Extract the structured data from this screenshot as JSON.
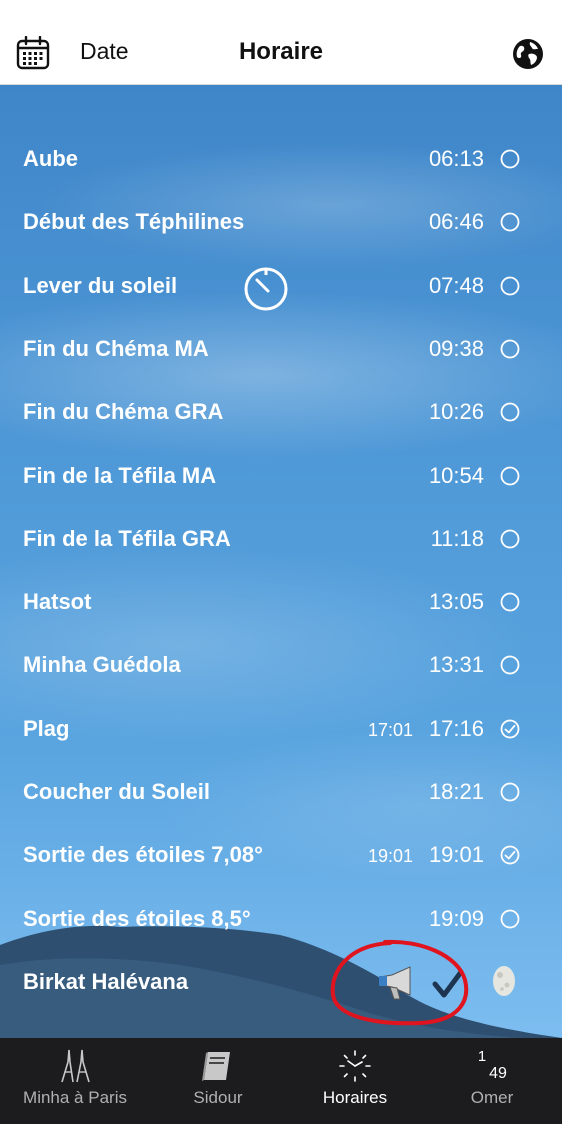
{
  "header": {
    "date_label": "Date",
    "title": "Horaire",
    "calendar_icon": "calendar-icon",
    "globe_icon": "globe-icon"
  },
  "zmanim": [
    {
      "label": "Aube",
      "time": "06:13",
      "alt": "",
      "checked": false
    },
    {
      "label": "Début des Téphilines",
      "time": "06:46",
      "alt": "",
      "checked": false
    },
    {
      "label": "Lever du soleil",
      "time": "07:48",
      "alt": "",
      "checked": false
    },
    {
      "label": "Fin du Chéma MA",
      "time": "09:38",
      "alt": "",
      "checked": false
    },
    {
      "label": "Fin du Chéma GRA",
      "time": "10:26",
      "alt": "",
      "checked": false
    },
    {
      "label": "Fin de la Téfila MA",
      "time": "10:54",
      "alt": "",
      "checked": false
    },
    {
      "label": "Fin de la Téfila GRA",
      "time": "11:18",
      "alt": "",
      "checked": false
    },
    {
      "label": "Hatsot",
      "time": "13:05",
      "alt": "",
      "checked": false
    },
    {
      "label": "Minha Guédola",
      "time": "13:31",
      "alt": "",
      "checked": false
    },
    {
      "label": "Plag",
      "time": "17:16",
      "alt": "17:01",
      "checked": true
    },
    {
      "label": "Coucher du Soleil",
      "time": "18:21",
      "alt": "",
      "checked": false
    },
    {
      "label": "Sortie des étoiles 7,08°",
      "time": "19:01",
      "alt": "19:01",
      "checked": true
    },
    {
      "label": "Sortie des étoiles 8,5°",
      "time": "19:09",
      "alt": "",
      "checked": false
    }
  ],
  "birkat": {
    "label": "Birkat Halévana",
    "icons": [
      "megaphone-icon",
      "checkmark-icon",
      "moon-icon"
    ]
  },
  "tabs": [
    {
      "label": "Minha à Paris",
      "icon": "eiffel-tower-icon",
      "active": false
    },
    {
      "label": "Sidour",
      "icon": "book-icon",
      "active": false
    },
    {
      "label": "Horaires",
      "icon": "clock-icon",
      "active": true
    },
    {
      "label": "Omer",
      "icon": "omer-counter",
      "active": false,
      "week": "1",
      "day": "49"
    }
  ],
  "colors": {
    "header_bg": "#ffffff",
    "sky_top": "#3f86c9",
    "sky_bottom": "#7dbdf0",
    "tabbar_bg": "#1c1c1e",
    "annotation_red": "#e0141e"
  }
}
